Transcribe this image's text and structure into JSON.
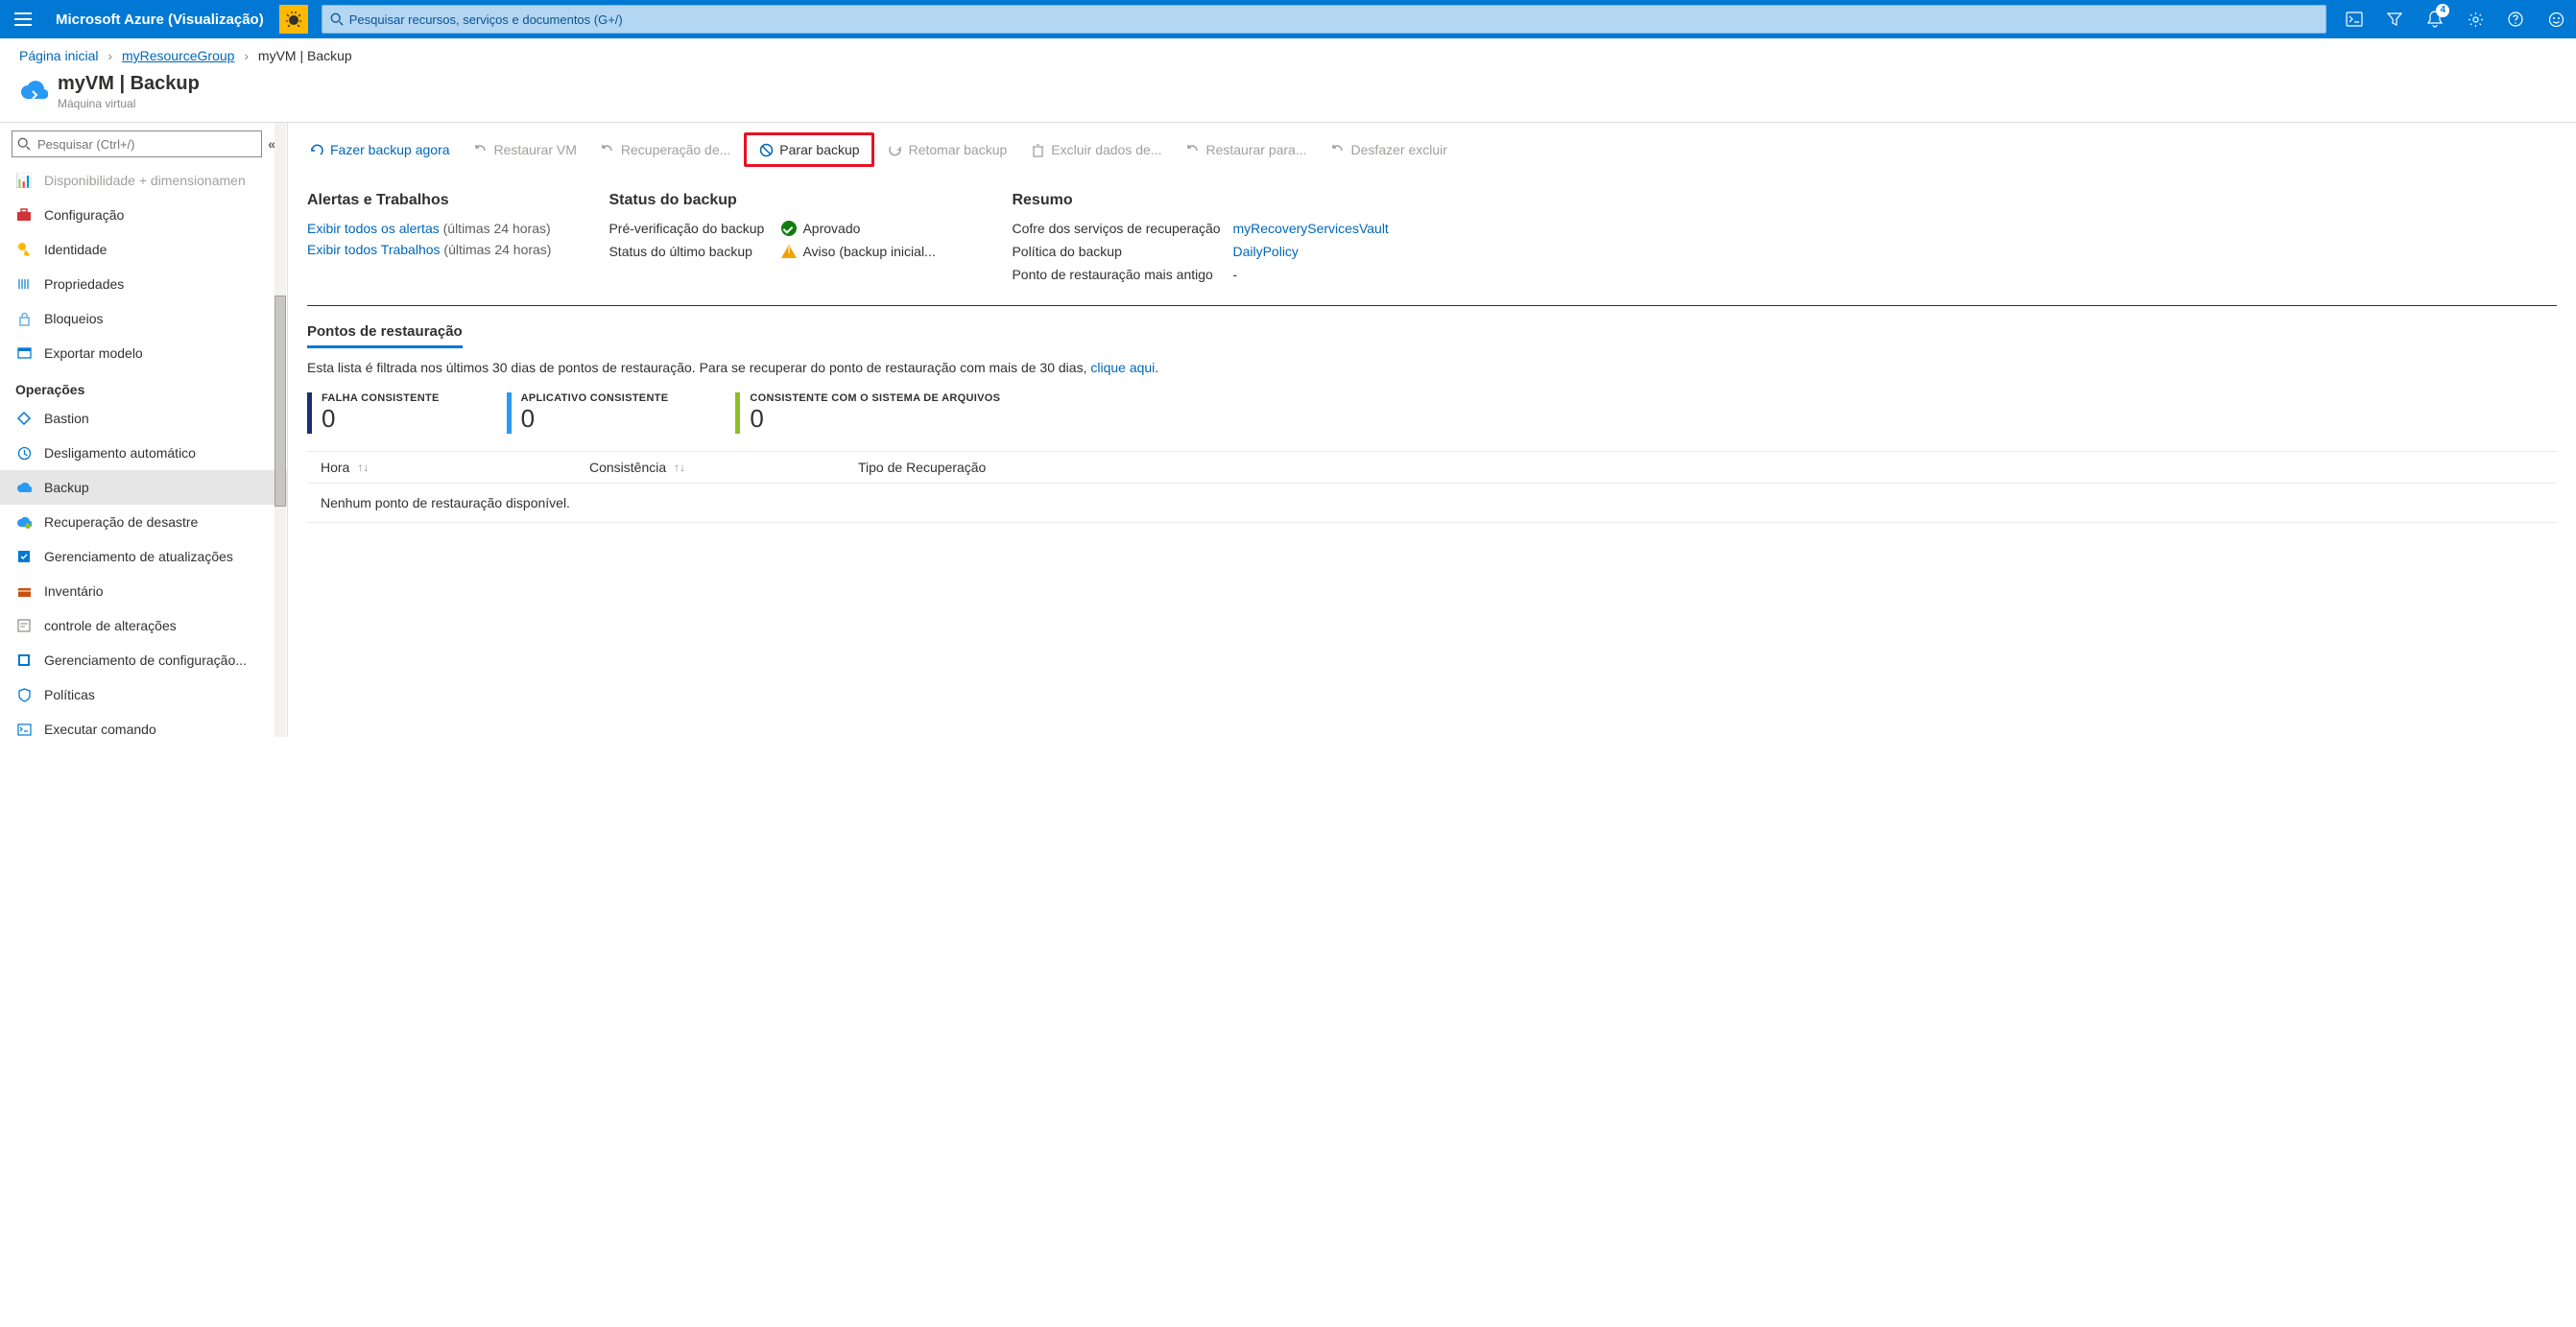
{
  "topbar": {
    "brand": "Microsoft Azure (Visualização)",
    "search_placeholder": "Pesquisar recursos, serviços e documentos (G+/)",
    "notification_count": "4"
  },
  "breadcrumb": {
    "home": "Página inicial",
    "rg": "myResourceGroup",
    "current": "myVM | Backup"
  },
  "header": {
    "title": "myVM | Backup",
    "subtitle": "Máquina virtual"
  },
  "sidebar": {
    "search_placeholder": "Pesquisar (Ctrl+/)",
    "items_top": [
      "Disponibilidade + dimensionamen",
      "Configuração",
      "Identidade",
      "Propriedades",
      "Bloqueios",
      "Exportar modelo"
    ],
    "section": "Operações",
    "items_ops": [
      "Bastion",
      "Desligamento automático",
      "Backup",
      "Recuperação de desastre",
      "Gerenciamento de atualizações",
      "Inventário",
      "controle de alterações",
      "Gerenciamento de configuração...",
      "Políticas",
      "Executar comando"
    ]
  },
  "toolbar": {
    "backup_now": "Fazer backup agora",
    "restore_vm": "Restaurar VM",
    "recovery_of": "Recuperação de...",
    "stop_backup": "Parar backup",
    "resume_backup": "Retomar backup",
    "delete_data": "Excluir dados de...",
    "restore_to": "Restaurar para...",
    "undo_delete": "Desfazer excluir"
  },
  "alerts": {
    "heading": "Alertas e Trabalhos",
    "view_alerts": "Exibir todos os alertas",
    "view_jobs": "Exibir todos Trabalhos",
    "period": "(últimas 24 horas)"
  },
  "status": {
    "heading": "Status do backup",
    "precheck_label": "Pré-verificação do backup",
    "precheck_value": "Aprovado",
    "last_label": "Status do último backup",
    "last_value": "Aviso (backup inicial..."
  },
  "summary": {
    "heading": "Resumo",
    "vault_label": "Cofre dos serviços de recuperação",
    "vault_value": "myRecoveryServicesVault",
    "policy_label": "Política do backup",
    "policy_value": "DailyPolicy",
    "oldest_label": "Ponto de restauração mais antigo",
    "oldest_value": "-"
  },
  "restore": {
    "tab": "Pontos de restauração",
    "filter_text": "Esta lista é filtrada nos últimos 30 dias de pontos de restauração. Para se recuperar do ponto de restauração com mais de 30 dias, ",
    "filter_link": "clique aqui",
    "c1_label": "FALHA CONSISTENTE",
    "c1_val": "0",
    "c2_label": "APLICATIVO CONSISTENTE",
    "c2_val": "0",
    "c3_label": "CONSISTENTE COM O SISTEMA DE ARQUIVOS",
    "c3_val": "0"
  },
  "table": {
    "col_time": "Hora",
    "col_consistency": "Consistência",
    "col_type": "Tipo de Recuperação",
    "empty": "Nenhum ponto de restauração disponível."
  }
}
